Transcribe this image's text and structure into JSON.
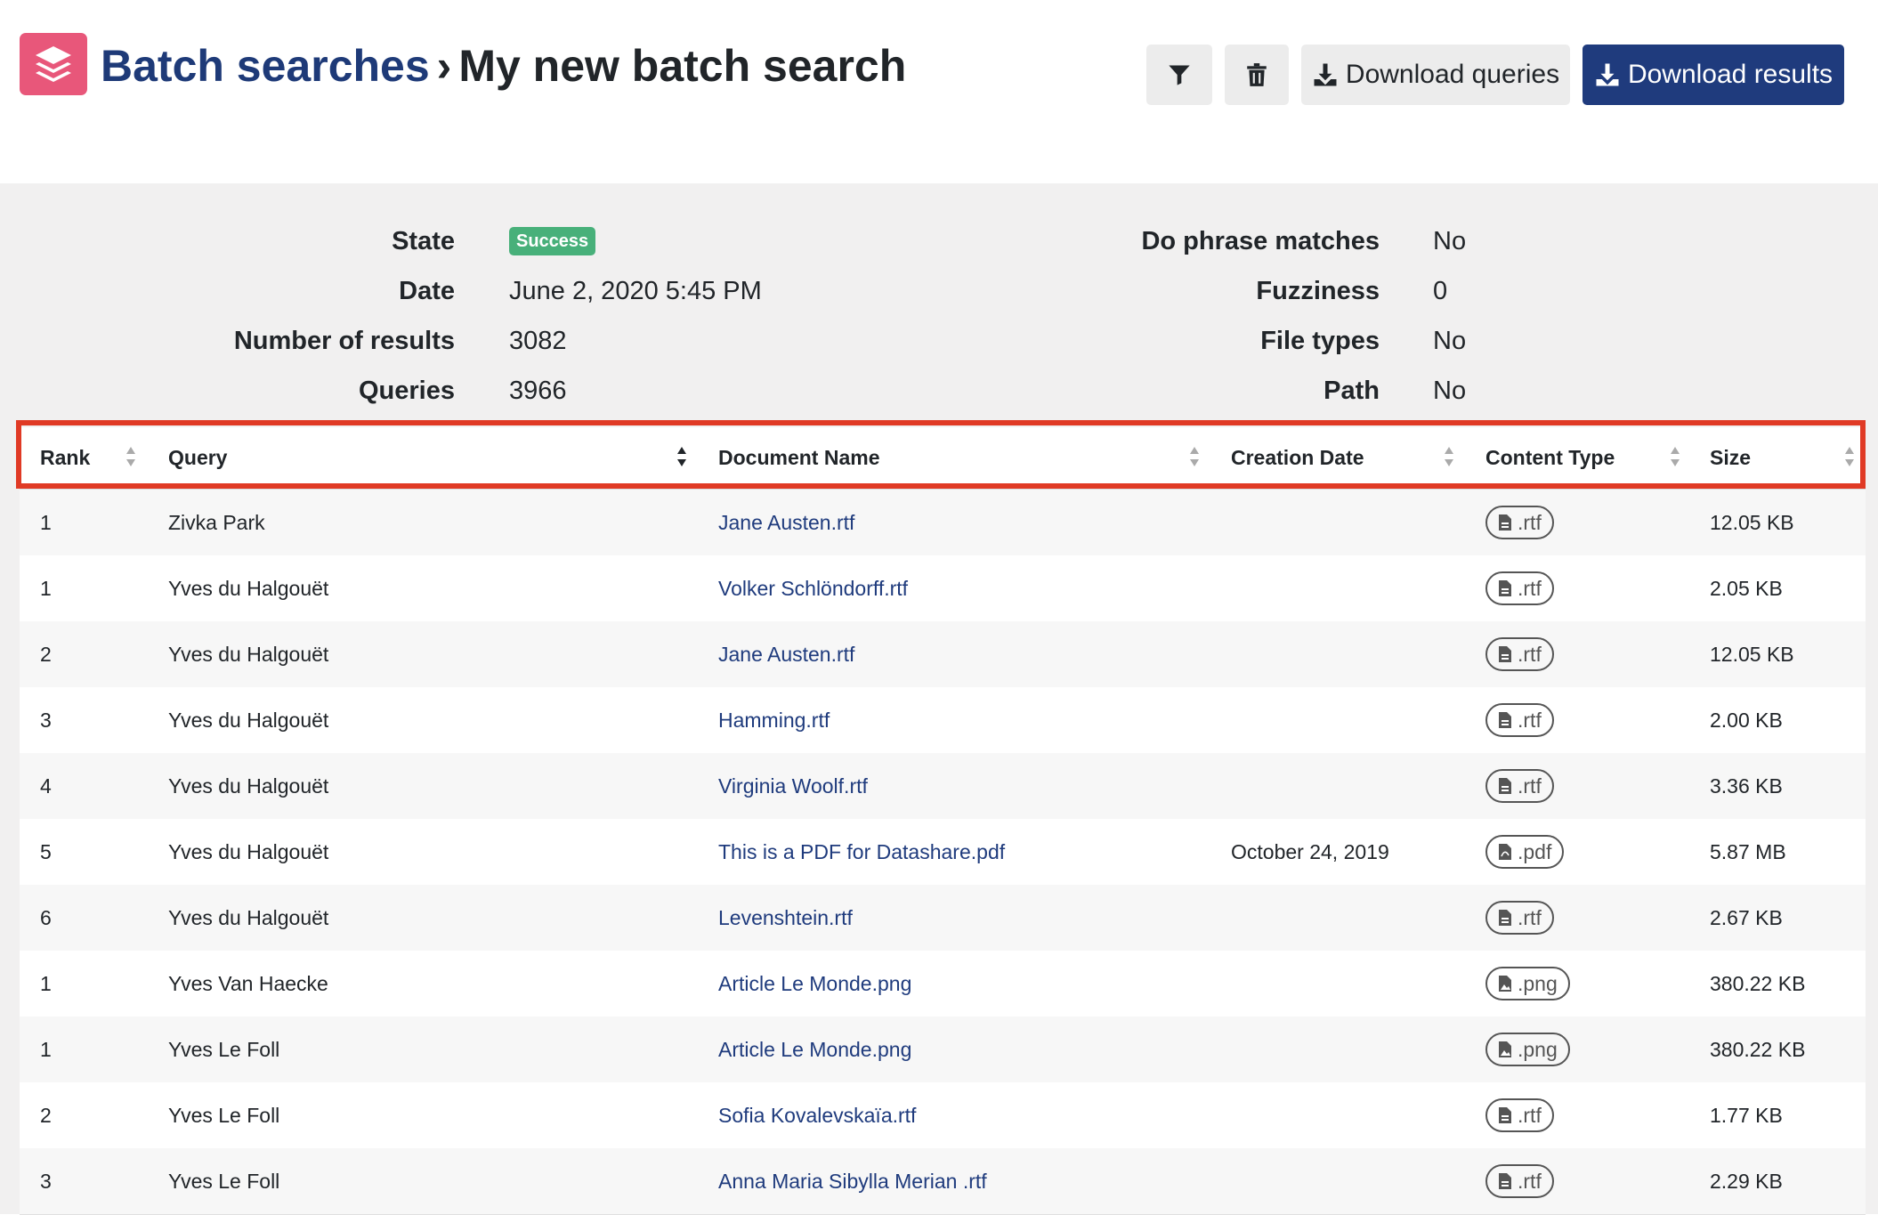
{
  "header": {
    "breadcrumb_parent": "Batch searches",
    "breadcrumb_separator": "›",
    "title": "My new batch search",
    "buttons": {
      "download_queries": "Download queries",
      "download_results": "Download results"
    },
    "colors": {
      "logo": "#e8577a",
      "primary": "#1f3b7d",
      "highlight": "#e03a25"
    }
  },
  "summary": {
    "left": [
      {
        "label": "State",
        "value": "Success",
        "badge": true
      },
      {
        "label": "Date",
        "value": "June 2, 2020 5:45 PM"
      },
      {
        "label": "Number of results",
        "value": "3082"
      },
      {
        "label": "Queries",
        "value": "3966"
      }
    ],
    "right": [
      {
        "label": "Do phrase matches",
        "value": "No"
      },
      {
        "label": "Fuzziness",
        "value": "0"
      },
      {
        "label": "File types",
        "value": "No"
      },
      {
        "label": "Path",
        "value": "No"
      }
    ]
  },
  "table": {
    "columns": [
      "Rank",
      "Query",
      "Document Name",
      "Creation Date",
      "Content Type",
      "Size"
    ],
    "rows": [
      {
        "rank": "1",
        "query": "Zivka Park",
        "document": "Jane Austen.rtf",
        "date": "",
        "type": ".rtf",
        "size": "12.05 KB"
      },
      {
        "rank": "1",
        "query": "Yves du Halgouët",
        "document": "Volker Schlöndorff.rtf",
        "date": "",
        "type": ".rtf",
        "size": "2.05 KB"
      },
      {
        "rank": "2",
        "query": "Yves du Halgouët",
        "document": "Jane Austen.rtf",
        "date": "",
        "type": ".rtf",
        "size": "12.05 KB"
      },
      {
        "rank": "3",
        "query": "Yves du Halgouët",
        "document": "Hamming.rtf",
        "date": "",
        "type": ".rtf",
        "size": "2.00 KB"
      },
      {
        "rank": "4",
        "query": "Yves du Halgouët",
        "document": "Virginia Woolf.rtf",
        "date": "",
        "type": ".rtf",
        "size": "3.36 KB"
      },
      {
        "rank": "5",
        "query": "Yves du Halgouët",
        "document": "This is a PDF for Datashare.pdf",
        "date": "October 24, 2019",
        "type": ".pdf",
        "size": "5.87 MB"
      },
      {
        "rank": "6",
        "query": "Yves du Halgouët",
        "document": "Levenshtein.rtf",
        "date": "",
        "type": ".rtf",
        "size": "2.67 KB"
      },
      {
        "rank": "1",
        "query": "Yves Van Haecke",
        "document": "Article Le Monde.png",
        "date": "",
        "type": ".png",
        "size": "380.22 KB"
      },
      {
        "rank": "1",
        "query": "Yves Le Foll",
        "document": "Article Le Monde.png",
        "date": "",
        "type": ".png",
        "size": "380.22 KB"
      },
      {
        "rank": "2",
        "query": "Yves Le Foll",
        "document": "Sofia Kovalevskaïa.rtf",
        "date": "",
        "type": ".rtf",
        "size": "1.77 KB"
      },
      {
        "rank": "3",
        "query": "Yves Le Foll",
        "document": "Anna Maria Sibylla Merian .rtf",
        "date": "",
        "type": ".rtf",
        "size": "2.29 KB"
      }
    ]
  }
}
